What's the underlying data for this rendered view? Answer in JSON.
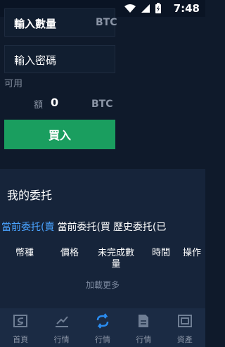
{
  "status_bar": {
    "time": "7:48"
  },
  "trade": {
    "quantity_label": "輸入數量",
    "quantity_unit": "BTC",
    "password_label": "輸入密碼",
    "available_label": "可用",
    "amount_label": "額",
    "amount_value": "0",
    "amount_unit": "BTC",
    "buy_label": "買入"
  },
  "orders": {
    "title": "我的委托",
    "tabs": [
      {
        "label": "當前委托(賣"
      },
      {
        "label": "當前委托(買"
      },
      {
        "label": "歷史委托(已"
      }
    ],
    "columns": {
      "type": "幣種",
      "price": "價格",
      "remaining": "未完成數量",
      "time": "時間",
      "action": "操作"
    },
    "load_more": "加載更多"
  },
  "navbar": {
    "items": [
      {
        "label": "首頁",
        "icon": "home-logo-icon"
      },
      {
        "label": "行情",
        "icon": "market-icon"
      },
      {
        "label": "行情",
        "icon": "exchange-icon"
      },
      {
        "label": "行情",
        "icon": "document-icon"
      },
      {
        "label": "資產",
        "icon": "wallet-icon"
      }
    ],
    "active_color": "#2a8cf0",
    "inactive_color": "#6f7e94"
  },
  "colors": {
    "buy": "#1a9e5f",
    "background": "#0f1a2b",
    "panel": "#16243a"
  }
}
